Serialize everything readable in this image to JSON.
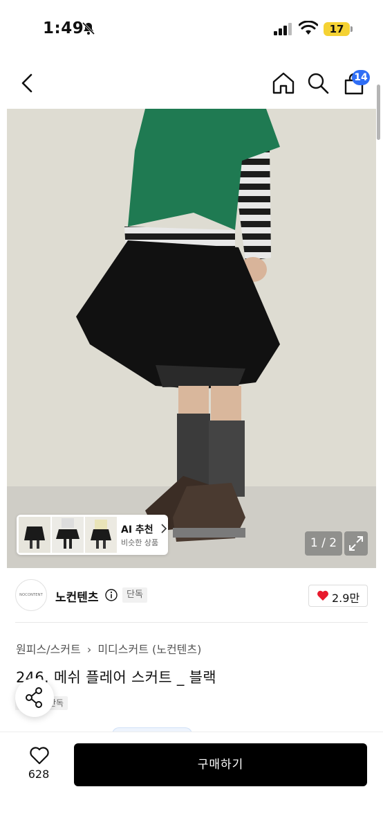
{
  "status_bar": {
    "time": "1:49",
    "battery": "17"
  },
  "nav": {
    "back_icon": "chevron-left-icon",
    "home_icon": "home-icon",
    "search_icon": "search-icon",
    "cart_icon": "shopping-bag-icon",
    "cart_count": "14"
  },
  "gallery": {
    "ai_recommend_title": "AI 추천",
    "ai_recommend_sub": "비슷한 상품",
    "page_indicator": "1 / 2",
    "expand_icon": "expand-icon"
  },
  "store": {
    "logo_text": "NOCONTENT",
    "name": "노컨텐츠",
    "exclusive": "단독",
    "like_count": "2.9만"
  },
  "product": {
    "breadcrumb_parent": "원피스/스커트",
    "breadcrumb_child": "미디스커트 (노컨텐츠)",
    "title": "246. 메쉬 플레어 스커트 _ 블랙",
    "exclusive_tag": "단독"
  },
  "bottom_bar": {
    "wish_count": "628",
    "buy_label": "구매하기"
  },
  "colors": {
    "accent_badge": "#2f6ef5",
    "heart": "#e8192c",
    "buy_button": "#000000"
  }
}
